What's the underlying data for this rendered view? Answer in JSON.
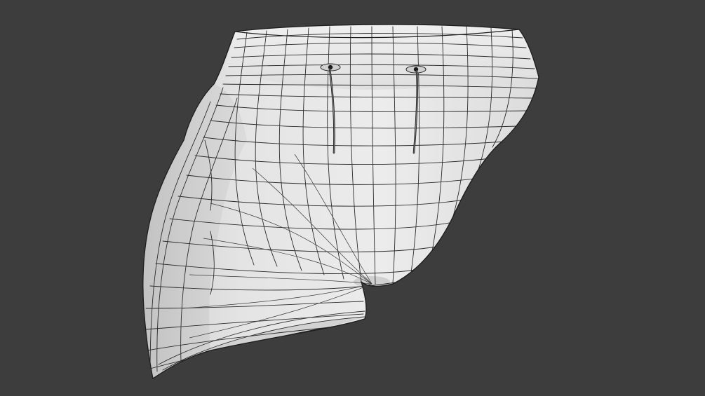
{
  "viewport": {
    "background_color": "#3d3d3d",
    "mesh_color": "#e6e6e6",
    "wire_color": "#2b2b2b",
    "shading": "solid",
    "overlay": "wireframe"
  },
  "object": {
    "type": "mesh",
    "depicts": "shorts",
    "features": [
      "waistband",
      "drawstring-left",
      "drawstring-right",
      "leg-opening"
    ]
  }
}
